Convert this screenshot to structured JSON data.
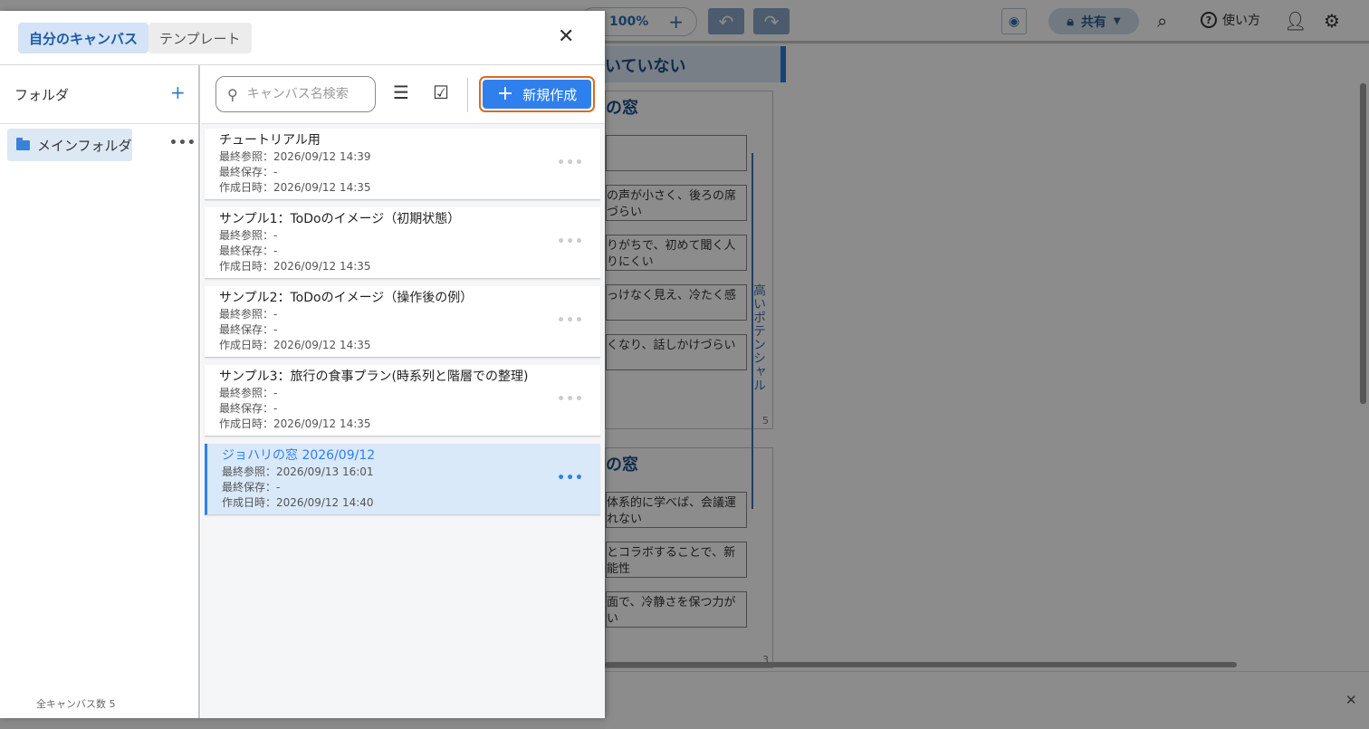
{
  "background": {
    "zoom": "100%",
    "share_label": "共有",
    "help_label": "使い方",
    "board_header": "いていない",
    "section1_title": "の窓",
    "section1_num": "5",
    "section2_title": "の窓",
    "section2_num": "3",
    "stickies_top": [
      "",
      "の声が小さく、後ろの席\nづらい",
      "りがちで、初めて聞く人\nりにくい",
      "っけなく見え、冷たく感",
      "くなり、話しかけづらい"
    ],
    "stickies_bottom": [
      "体系的に学べば、会議運\nれない",
      "とコラボすることで、新\n能性",
      "面で、冷静さを保つ力が\nい"
    ],
    "vertical_label": "高いポテンシャル"
  },
  "modal": {
    "tabs": [
      {
        "label": "自分のキャンバス"
      },
      {
        "label": "テンプレート"
      }
    ],
    "sidebar": {
      "title": "フォルダ",
      "folders": [
        {
          "label": "メインフォルダ"
        }
      ],
      "count_label": "全キャンバス数 5"
    },
    "toolbar": {
      "search_placeholder": "キャンバス名検索",
      "new_label": "新規作成"
    },
    "canvases": [
      {
        "title": "チュートリアル用",
        "last_viewed": "最終参照：2026/09/12 14:39",
        "last_saved": "最終保存：-",
        "created": "作成日時：2026/09/12 14:35"
      },
      {
        "title": "サンプル1：ToDoのイメージ（初期状態）",
        "last_viewed": "最終参照：-",
        "last_saved": "最終保存：-",
        "created": "作成日時：2026/09/12 14:35"
      },
      {
        "title": "サンプル2：ToDoのイメージ（操作後の例）",
        "last_viewed": "最終参照：-",
        "last_saved": "最終保存：-",
        "created": "作成日時：2026/09/12 14:35"
      },
      {
        "title": "サンプル3：旅行の食事プラン(時系列と階層での整理)",
        "last_viewed": "最終参照：-",
        "last_saved": "最終保存：-",
        "created": "作成日時：2026/09/12 14:35"
      },
      {
        "title": "ジョハリの窓 2026/09/12",
        "last_viewed": "最終参照：2026/09/13 16:01",
        "last_saved": "最終保存：-",
        "created": "作成日時：2026/09/12 14:40",
        "selected": true
      }
    ]
  }
}
